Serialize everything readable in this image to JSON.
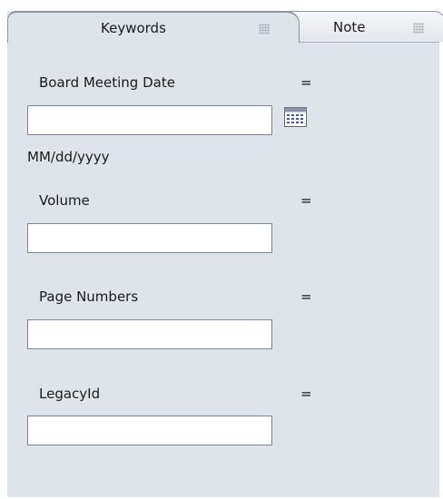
{
  "tabs": [
    {
      "label": "Keywords",
      "active": true
    },
    {
      "label": "Note",
      "active": false
    }
  ],
  "fields": {
    "board_meeting_date": {
      "label": "Board Meeting Date",
      "operator": "=",
      "value": "",
      "format_hint": "MM/dd/yyyy"
    },
    "volume": {
      "label": "Volume",
      "operator": "=",
      "value": ""
    },
    "page_numbers": {
      "label": "Page Numbers",
      "operator": "=",
      "value": ""
    },
    "legacy_id": {
      "label": "LegacyId",
      "operator": "=",
      "value": ""
    }
  },
  "icons": {
    "calendar": "calendar-icon",
    "grip": "grip-icon"
  }
}
